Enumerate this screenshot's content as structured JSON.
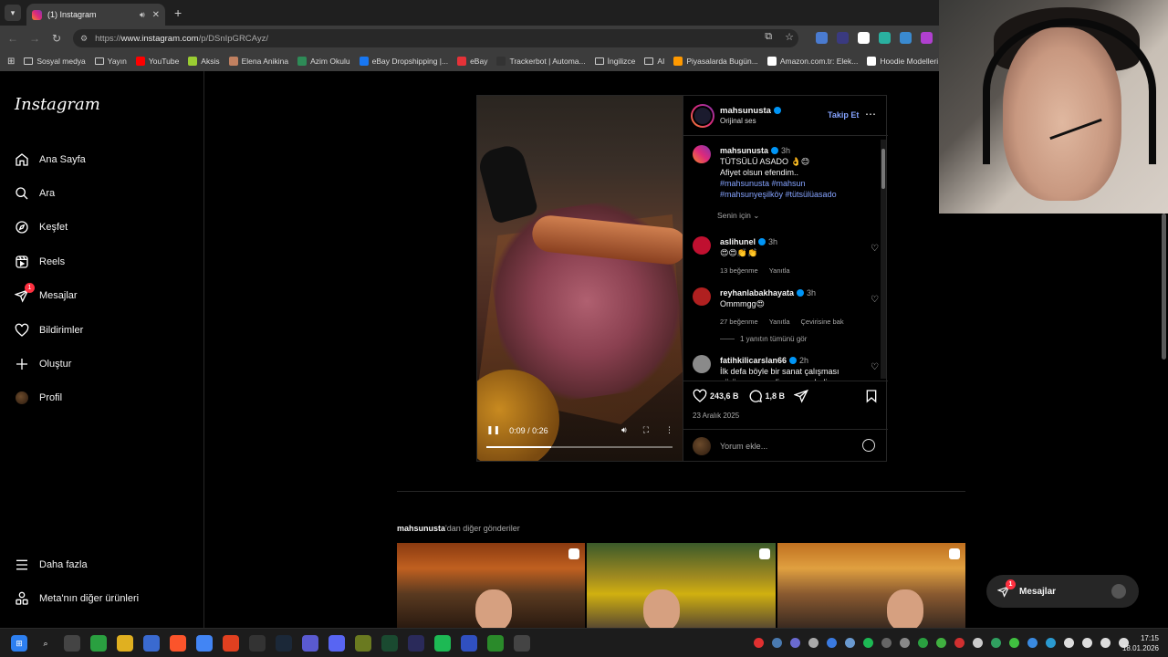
{
  "browser": {
    "tab": {
      "title": "(1) Instagram"
    },
    "url": {
      "prefix": "https://",
      "host": "www.instagram.com",
      "path": "/p/DSnIpGRCAyz/"
    },
    "bookmarks": [
      {
        "label": "Sosyal medya",
        "type": "folder"
      },
      {
        "label": "Yayın",
        "type": "folder"
      },
      {
        "label": "YouTube",
        "type": "link",
        "color": "#ff0000"
      },
      {
        "label": "Aksis",
        "type": "link",
        "color": "#9acd32"
      },
      {
        "label": "Elena Anikina",
        "type": "link",
        "color": "#c08060"
      },
      {
        "label": "Azim Okulu",
        "type": "link",
        "color": "#2e8b57"
      },
      {
        "label": "eBay Dropshipping |...",
        "type": "link",
        "color": "#1877f2"
      },
      {
        "label": "eBay",
        "type": "link",
        "color": "#e53238"
      },
      {
        "label": "Trackerbot | Automa...",
        "type": "link",
        "color": "#333333"
      },
      {
        "label": "İngilizce",
        "type": "folder"
      },
      {
        "label": "AI",
        "type": "folder"
      },
      {
        "label": "Piyasalarda Bugün...",
        "type": "link",
        "color": "#ff9900"
      },
      {
        "label": "Amazon.com.tr: Elek...",
        "type": "link",
        "color": "#ffffff"
      },
      {
        "label": "Hoodie Modelleri |",
        "type": "link",
        "color": "#ffffff"
      }
    ]
  },
  "sidebar": {
    "logo": "Instagram",
    "items": [
      {
        "label": "Ana Sayfa",
        "icon": "home-icon"
      },
      {
        "label": "Ara",
        "icon": "search-icon"
      },
      {
        "label": "Keşfet",
        "icon": "compass-icon"
      },
      {
        "label": "Reels",
        "icon": "reels-icon"
      },
      {
        "label": "Mesajlar",
        "icon": "messenger-icon",
        "badge": "1"
      },
      {
        "label": "Bildirimler",
        "icon": "heart-icon"
      },
      {
        "label": "Oluştur",
        "icon": "plus-icon"
      },
      {
        "label": "Profil",
        "icon": "avatar"
      }
    ],
    "bottom": [
      {
        "label": "Daha fazla",
        "icon": "menu-icon"
      },
      {
        "label": "Meta'nın diğer ürünleri",
        "icon": "meta-apps-icon"
      }
    ]
  },
  "post": {
    "author": "mahsunusta",
    "audio": "Orijinal ses",
    "follow": "Takip Et",
    "caption": {
      "time": "3h",
      "lines": [
        "TÜTSÜLÜ ASADO 👌😊",
        "Afiyet olsun efendim.."
      ],
      "hashtags": [
        "#mahsunusta #mahsun",
        "#mahsunyeşilköy #tütsülüasado"
      ]
    },
    "for_you": "Senin için",
    "comments": [
      {
        "user": "aslihunel",
        "time": "3h",
        "text": "😍😍👏👏",
        "likes": "13 beğenme",
        "reply": "Yanıtla",
        "translate": ""
      },
      {
        "user": "reyhanlabakhayata",
        "time": "3h",
        "text": "Ommmgg😍",
        "likes": "27 beğenme",
        "reply": "Yanıtla",
        "translate": "Çevirisine bak"
      },
      {
        "user": "fatihkilicarslan66",
        "time": "2h",
        "text": "İlk defa böyle bir sanat çalışması görüyorum, nedir ve neredediır",
        "likes": "",
        "reply": "",
        "translate": ""
      }
    ],
    "view_replies": "1 yanıtın tümünü gör",
    "likes": "243,6 B",
    "comment_count": "1,8 B",
    "date": "23 Aralık 2025",
    "add_comment_placeholder": "Yorum ekle...",
    "video": {
      "time": "0:09 / 0:26",
      "progress": 0.346
    }
  },
  "more": {
    "user": "mahsunusta",
    "suffix": "'dan diğer gönderiler"
  },
  "messages_pill": {
    "label": "Mesajlar",
    "badge": "1"
  },
  "taskbar": {
    "time": "17:15",
    "date": "18.01.2026"
  }
}
